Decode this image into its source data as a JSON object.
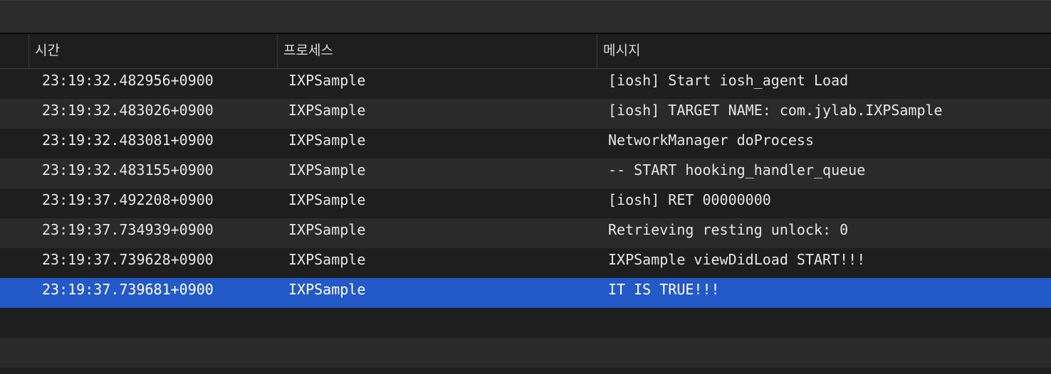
{
  "columns": {
    "time": "시간",
    "process": "프로세스",
    "message": "메시지"
  },
  "rows": [
    {
      "time": "23:19:32.482956+0900",
      "process": "IXPSample",
      "message": "[iosh] Start iosh_agent Load",
      "selected": false
    },
    {
      "time": "23:19:32.483026+0900",
      "process": "IXPSample",
      "message": "[iosh] TARGET NAME: com.jylab.IXPSample",
      "selected": false
    },
    {
      "time": "23:19:32.483081+0900",
      "process": "IXPSample",
      "message": "NetworkManager doProcess",
      "selected": false
    },
    {
      "time": "23:19:32.483155+0900",
      "process": "IXPSample",
      "message": "-- START hooking_handler_queue",
      "selected": false
    },
    {
      "time": "23:19:37.492208+0900",
      "process": "IXPSample",
      "message": "[iosh] RET 00000000",
      "selected": false
    },
    {
      "time": "23:19:37.734939+0900",
      "process": "IXPSample",
      "message": "Retrieving resting unlock: 0",
      "selected": false
    },
    {
      "time": "23:19:37.739628+0900",
      "process": "IXPSample",
      "message": "IXPSample viewDidLoad START!!!",
      "selected": false
    },
    {
      "time": "23:19:37.739681+0900",
      "process": "IXPSample",
      "message": "IT IS TRUE!!!",
      "selected": true
    }
  ],
  "colors": {
    "selection": "#2459c8",
    "background": "#1e1e1e",
    "alt_row": "#2a2a2a"
  }
}
